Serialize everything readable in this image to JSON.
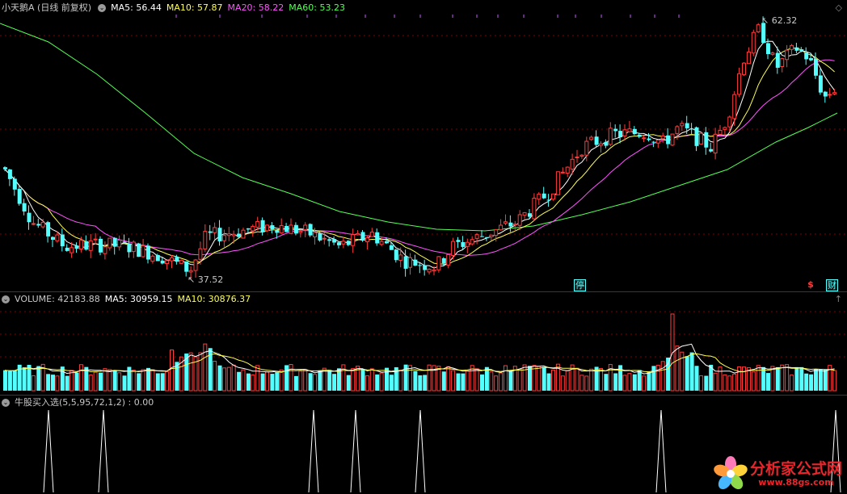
{
  "price": {
    "title": "小天鹅A (日线 前复权)",
    "ma5": "MA5: 56.44",
    "ma10": "MA10: 57.87",
    "ma20": "MA20: 58.22",
    "ma60": "MA60: 53.23",
    "high_label": "62.32",
    "low_label": "37.52",
    "badge_stop": "停",
    "badge_dollar": "$",
    "badge_fin": "财"
  },
  "volume": {
    "label": "VOLUME: 42183.88",
    "ma5": "MA5: 30959.15",
    "ma10": "MA10: 30876.37"
  },
  "indicator": {
    "label": "牛股买入选(5,5,95,72,1,2) : 0.00"
  },
  "watermark": {
    "name": "分析家公式网",
    "url": "www.88gs.com"
  },
  "colors": {
    "up": "#ff3c3c",
    "down": "#54ffff",
    "ma5": "#ffffff",
    "ma10": "#ffff54",
    "ma20": "#ff54ff",
    "ma60": "#54ff54",
    "separator": "#c00000",
    "grid": "#800000"
  },
  "icons": {
    "collapse": "circle-chevron-icon",
    "up_arrow": "up-arrow-icon",
    "diamond": "diamond-icon"
  }
}
